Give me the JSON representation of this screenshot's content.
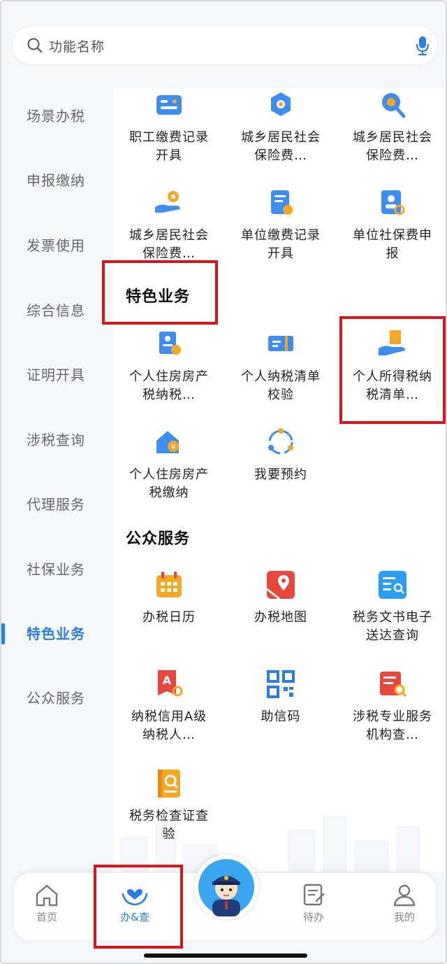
{
  "search": {
    "placeholder": "功能名称",
    "icon": "search-icon",
    "mic_icon": "microphone-icon"
  },
  "sidebar": {
    "items": [
      {
        "label": "场景办税",
        "active": false
      },
      {
        "label": "申报缴纳",
        "active": false
      },
      {
        "label": "发票使用",
        "active": false
      },
      {
        "label": "综合信息",
        "active": false
      },
      {
        "label": "证明开具",
        "active": false
      },
      {
        "label": "涉税查询",
        "active": false
      },
      {
        "label": "代理服务",
        "active": false
      },
      {
        "label": "社保业务",
        "active": false
      },
      {
        "label": "特色业务",
        "active": true
      },
      {
        "label": "公众服务",
        "active": false
      }
    ]
  },
  "content": {
    "social_rows": [
      {
        "label": "职工缴费记录开具",
        "icon": "id-card-icon"
      },
      {
        "label": "城乡居民社会保险费…",
        "icon": "settings-badge-icon"
      },
      {
        "label": "城乡居民社会保险费…",
        "icon": "search-badge-icon"
      },
      {
        "label": "城乡居民社会保险费…",
        "icon": "hand-coin-icon"
      },
      {
        "label": "单位缴费记录开具",
        "icon": "document-pen-icon"
      },
      {
        "label": "单位社保费申报",
        "icon": "person-search-icon"
      }
    ],
    "sections": [
      {
        "title": "特色业务",
        "items": [
          {
            "label": "个人住房房产税纳税…",
            "icon": "profile-card-icon"
          },
          {
            "label": "个人纳税清单校验",
            "icon": "ticket-check-icon"
          },
          {
            "label": "个人所得税纳税清单…",
            "icon": "hand-document-icon"
          },
          {
            "label": "个人住房房产税缴纳",
            "icon": "house-coin-icon"
          },
          {
            "label": "我要预约",
            "icon": "appointment-cycle-icon"
          }
        ]
      },
      {
        "title": "公众服务",
        "items": [
          {
            "label": "办税日历",
            "icon": "calendar-icon"
          },
          {
            "label": "办税地图",
            "icon": "map-pin-icon"
          },
          {
            "label": "税务文书电子送达查询",
            "icon": "document-search-icon"
          },
          {
            "label": "纳税信用A级纳税人…",
            "icon": "credit-a-icon"
          },
          {
            "label": "助信码",
            "icon": "qr-code-icon"
          },
          {
            "label": "涉税专业服务机构查…",
            "icon": "agency-search-icon"
          },
          {
            "label": "税务检查证查验",
            "icon": "certificate-search-icon"
          }
        ]
      }
    ]
  },
  "tabbar": {
    "tabs": [
      {
        "label": "首页",
        "icon": "home-icon",
        "active": false
      },
      {
        "label": "办&查",
        "icon": "heart-hands-icon",
        "active": true
      },
      {
        "label": "待办",
        "icon": "todo-icon",
        "active": false
      },
      {
        "label": "我的",
        "icon": "user-icon",
        "active": false
      }
    ],
    "center_icon": "tax-officer-avatar-icon"
  },
  "colors": {
    "accent": "#2a7de1",
    "highlight": "#d6161b",
    "icon_blue": "#3d8ef0",
    "icon_orange": "#f5a623",
    "icon_red": "#e8483b"
  }
}
